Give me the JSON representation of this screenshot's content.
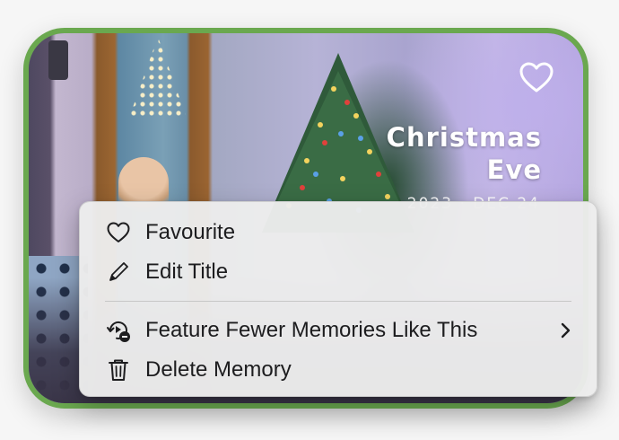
{
  "memory_card": {
    "title_line1": "Christmas",
    "title_line2": "Eve",
    "date": "2023 · DEC 24",
    "favourite_icon": "heart-outline-icon",
    "border_color": "#6aa84f"
  },
  "context_menu": {
    "items": [
      {
        "label": "Favourite",
        "icon": "heart-icon"
      },
      {
        "label": "Edit Title",
        "icon": "pencil-icon"
      },
      {
        "label": "Feature Fewer Memories Like This",
        "icon": "feature-fewer-icon",
        "has_submenu": true
      },
      {
        "label": "Delete Memory",
        "icon": "trash-icon"
      }
    ]
  },
  "colors": {
    "accent_border": "#6aa84f",
    "menu_background": "#ececec",
    "menu_text": "#1d1d1f"
  }
}
